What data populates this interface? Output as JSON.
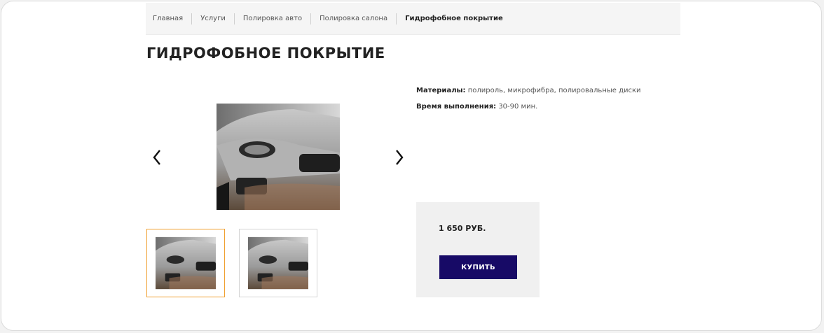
{
  "breadcrumb": {
    "items": [
      {
        "label": "Главная"
      },
      {
        "label": "Услуги"
      },
      {
        "label": "Полировка авто"
      },
      {
        "label": "Полировка салона"
      },
      {
        "label": "Гидрофобное покрытие"
      }
    ]
  },
  "page": {
    "title": "ГИДРОФОБНОЕ ПОКРЫТИЕ"
  },
  "gallery": {
    "prev_icon": "chevron-left-icon",
    "next_icon": "chevron-right-icon",
    "selected_thumb": 1
  },
  "details": {
    "materials_label": "Материалы:",
    "materials_value": " полироль, микрофибра, полировальные диски",
    "time_label": "Время выполнения:",
    "time_value": " 30-90 мин."
  },
  "purchase": {
    "price": "1 650 РУБ.",
    "buy_label": "КУПИТЬ"
  },
  "colors": {
    "accent_button": "#170a66",
    "thumb_selected_border": "#f0a030"
  }
}
